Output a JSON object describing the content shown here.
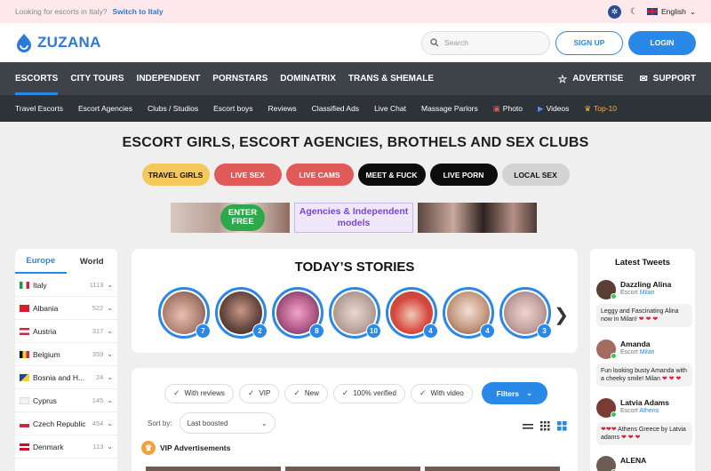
{
  "topbar": {
    "message": "Looking for escorts in Italy?",
    "switch_link": "Switch to Italy",
    "language": "English"
  },
  "header": {
    "brand": "ZUZANA",
    "search_placeholder": "Search",
    "signup": "SIGN UP",
    "login": "LOGIN"
  },
  "mainnav": {
    "items": [
      "ESCORTS",
      "CITY TOURS",
      "INDEPENDENT",
      "PORNSTARS",
      "DOMINATRIX",
      "TRANS & SHEMALE"
    ],
    "advertise": "ADVERTISE",
    "support": "SUPPORT"
  },
  "subnav": {
    "items": [
      "Travel Escorts",
      "Escort Agencies",
      "Clubs / Studios",
      "Escort boys",
      "Reviews",
      "Classified Ads",
      "Live Chat",
      "Massage Parlors",
      "Photo",
      "Videos",
      "Top-10"
    ]
  },
  "page": {
    "title": "ESCORT GIRLS, ESCORT AGENCIES, BROTHELS AND SEX CLUBS"
  },
  "pills": [
    {
      "label": "TRAVEL GIRLS",
      "bg": "#f5c85c",
      "fg": "#111111"
    },
    {
      "label": "LIVE SEX",
      "bg": "#e05a5a",
      "fg": "#ffffff"
    },
    {
      "label": "LIVE CAMS",
      "bg": "#e05a5a",
      "fg": "#ffffff"
    },
    {
      "label": "MEET & FUCK",
      "bg": "#0d0d0d",
      "fg": "#ffffff"
    },
    {
      "label": "LIVE PORN",
      "bg": "#0d0d0d",
      "fg": "#ffffff"
    },
    {
      "label": "LOCAL SEX",
      "bg": "#d3d3d3",
      "fg": "#111111"
    }
  ],
  "banners": {
    "enter_free": "ENTER FREE",
    "agencies": "Agencies & Independent models"
  },
  "sidebar": {
    "tabs": [
      "Europe",
      "World"
    ],
    "countries": [
      {
        "name": "Italy",
        "count": "1113"
      },
      {
        "name": "Albania",
        "count": "522"
      },
      {
        "name": "Austria",
        "count": "317"
      },
      {
        "name": "Belgium",
        "count": "359"
      },
      {
        "name": "Bosnia and H...",
        "count": "24"
      },
      {
        "name": "Cyprus",
        "count": "145"
      },
      {
        "name": "Czech Republic",
        "count": "454"
      },
      {
        "name": "Denmark",
        "count": "113"
      }
    ]
  },
  "stories": {
    "title": "TODAY’S STORIES",
    "items": [
      {
        "count": "7"
      },
      {
        "count": "2"
      },
      {
        "count": "8"
      },
      {
        "count": "10"
      },
      {
        "count": "4"
      },
      {
        "count": "4"
      },
      {
        "count": "3"
      }
    ]
  },
  "filters": {
    "chips": [
      "With reviews",
      "VIP",
      "New",
      "100% verified",
      "With video"
    ],
    "button": "Filters",
    "sort_label": "Sort by:",
    "sort_value": "Last boosted",
    "vip_heading": "VIP Advertisements"
  },
  "tweets": {
    "title": "Latest Tweets",
    "items": [
      {
        "name": "Dazzling Alina",
        "role": "Escort",
        "city": "Milan",
        "message": "Leggy and Fascinating Alina now in Milan!"
      },
      {
        "name": "Amanda",
        "role": "Escort",
        "city": "Milan",
        "message": "Fun looking busty Amanda with a cheeky smile! Milan"
      },
      {
        "name": "Latvia Adams",
        "role": "Escort",
        "city": "Athens",
        "message": "Athens Greece by Latvia adams"
      },
      {
        "name": "ALENA",
        "role": "",
        "city": "",
        "message": ""
      }
    ]
  }
}
